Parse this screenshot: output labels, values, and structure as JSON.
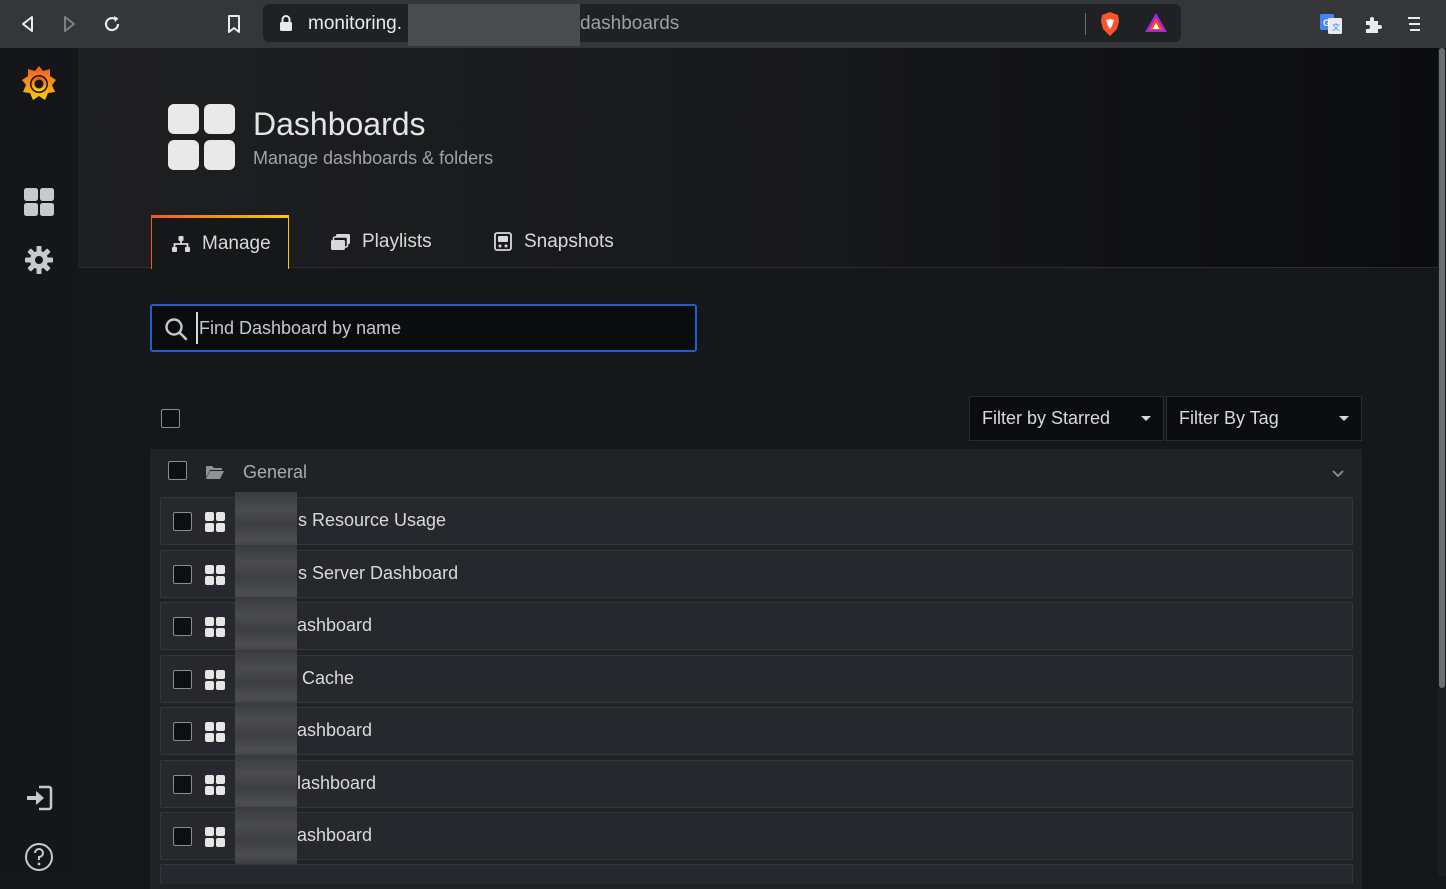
{
  "browser": {
    "url_prefix": "monitoring.",
    "url_suffix": "dashboards"
  },
  "page": {
    "title": "Dashboards",
    "subtitle": "Manage dashboards & folders"
  },
  "tabs": [
    {
      "label": "Manage"
    },
    {
      "label": "Playlists"
    },
    {
      "label": "Snapshots"
    }
  ],
  "search": {
    "placeholder": "Find Dashboard by name",
    "value": ""
  },
  "filters": {
    "starred_label": "Filter by Starred",
    "tag_label": "Filter By Tag"
  },
  "folder": {
    "name": "General"
  },
  "dashboards": [
    {
      "name_visible": "s Resource Usage"
    },
    {
      "name_visible": "s Server Dashboard"
    },
    {
      "name_visible": "ashboard"
    },
    {
      "name_visible": "Cache"
    },
    {
      "name_visible": "ashboard"
    },
    {
      "name_visible": "lashboard"
    },
    {
      "name_visible": "ashboard"
    }
  ],
  "colors": {
    "accent_blue": "#1f60c4",
    "grafana_orange": "#f05a28",
    "grafana_yellow": "#fbca0a",
    "background": "#161719"
  },
  "icons": {
    "sidebar": [
      "grafana-logo-icon",
      "dashboards-icon",
      "gear-icon",
      "sign-in-icon",
      "help-icon"
    ],
    "browser": [
      "back-icon",
      "forward-icon",
      "reload-icon",
      "bookmark-icon",
      "lock-icon",
      "brave-shield-icon",
      "brave-rewards-icon",
      "translate-icon",
      "extensions-icon",
      "menu-icon"
    ]
  }
}
